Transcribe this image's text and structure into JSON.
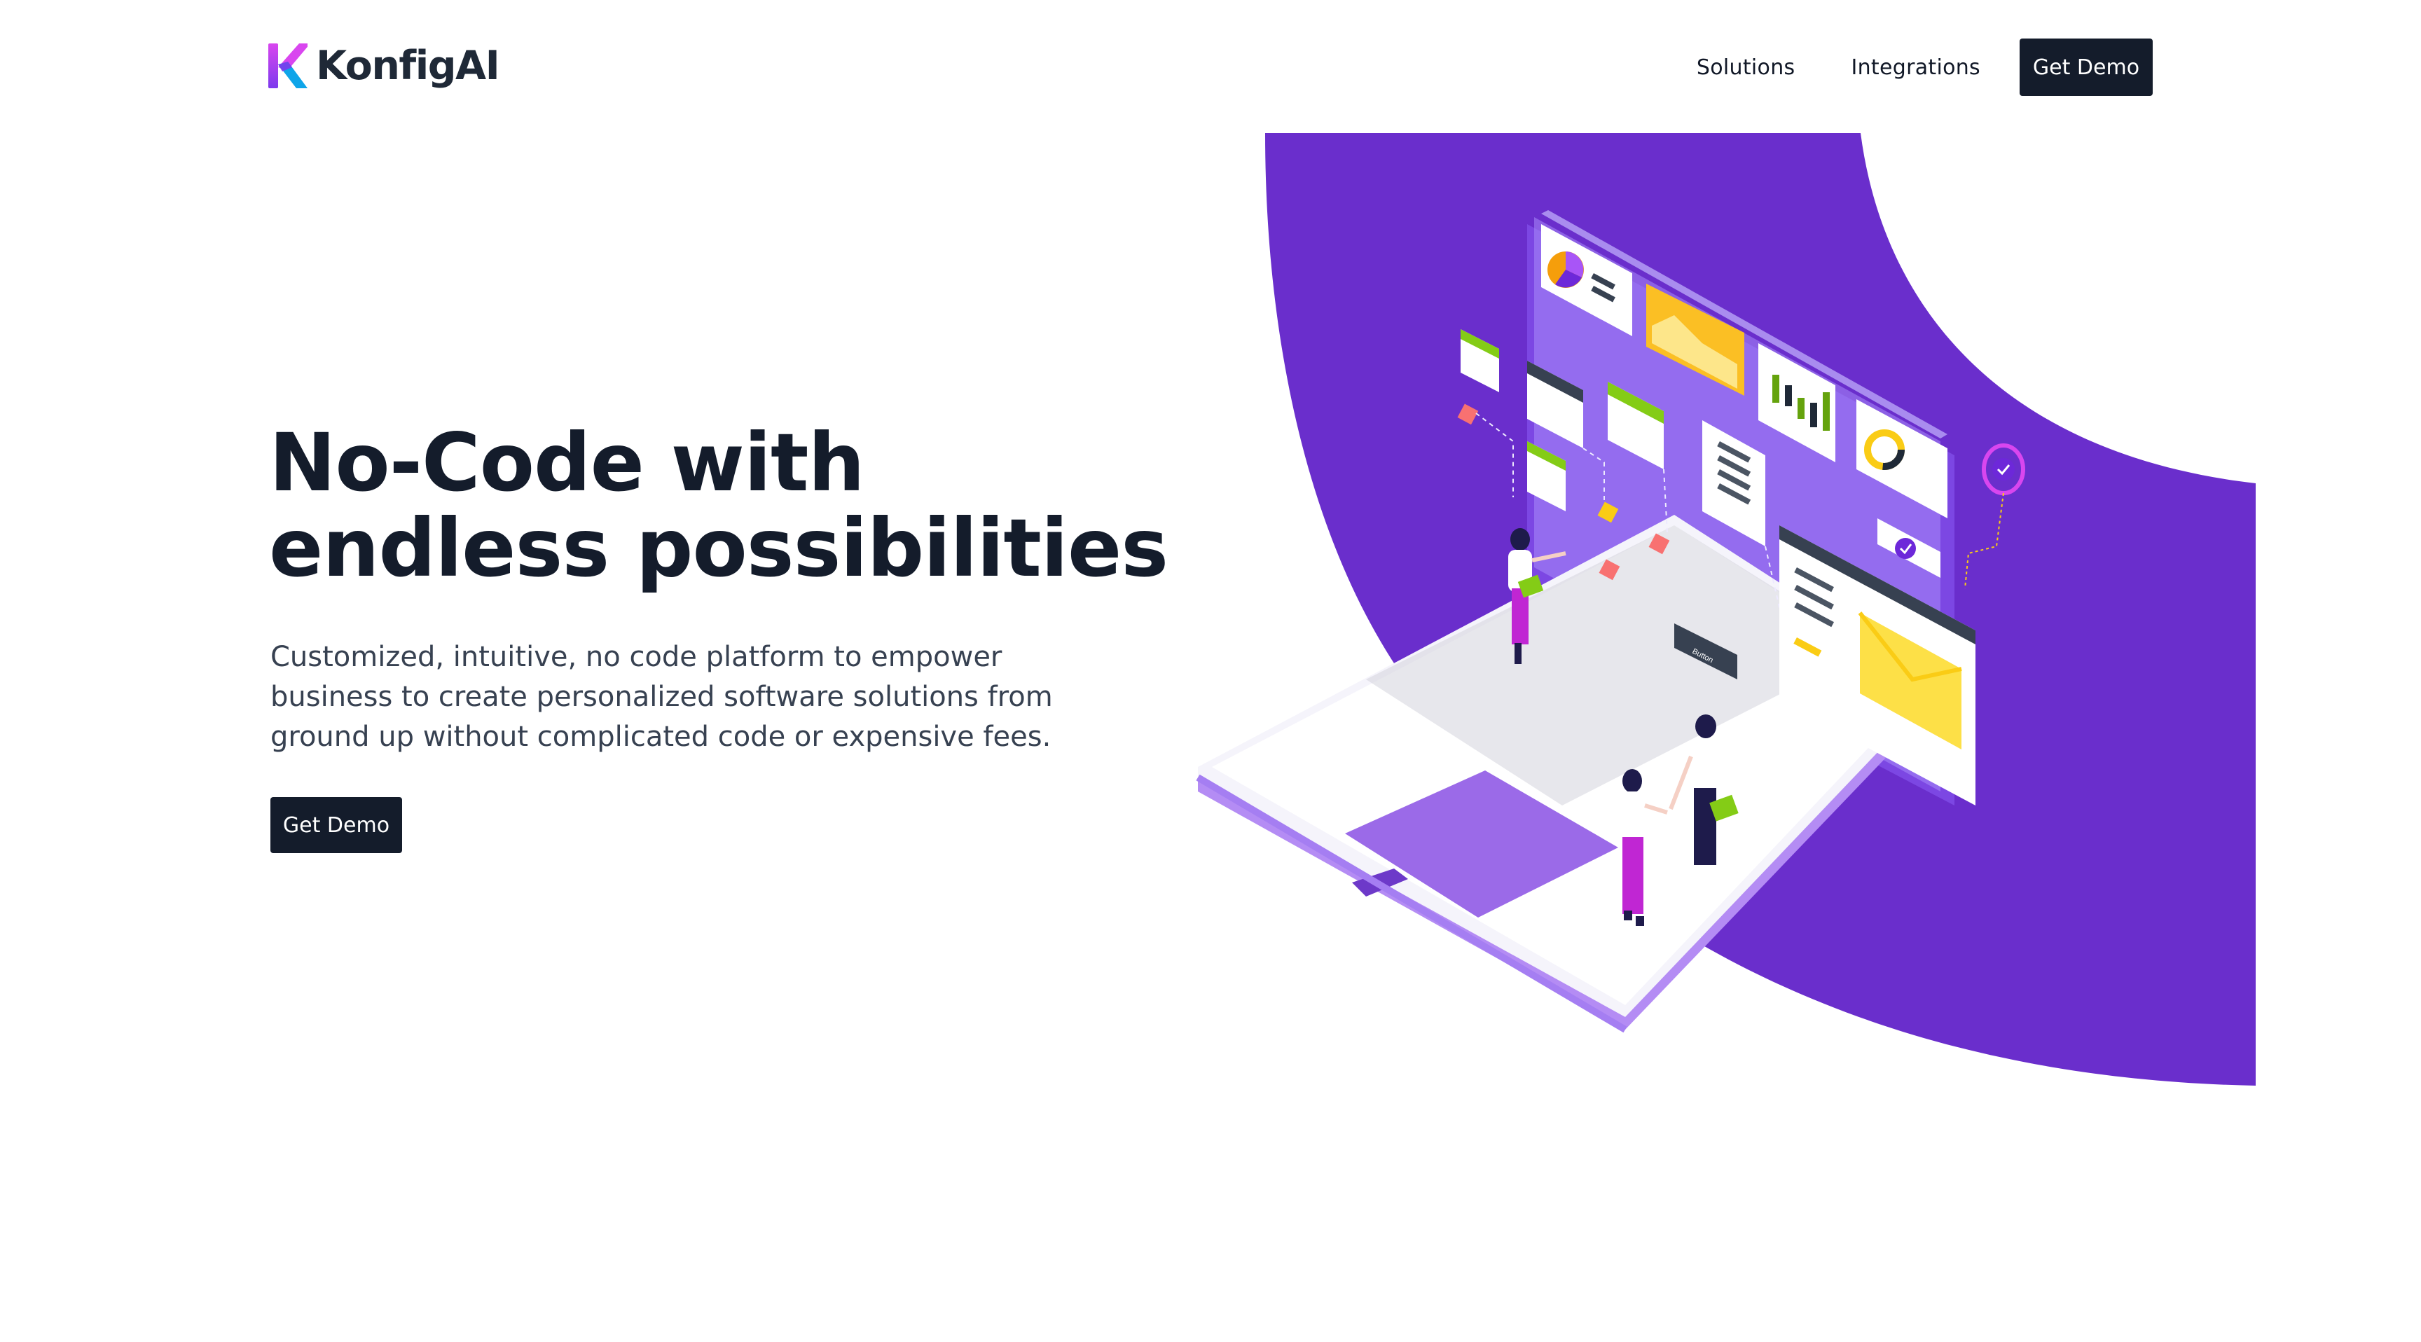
{
  "brand": {
    "name": "KonfigAI",
    "colors": {
      "pink": "#d946ef",
      "purple": "#7c3aed",
      "blue": "#0ea5e9"
    }
  },
  "nav": {
    "links": [
      "Solutions",
      "Integrations"
    ],
    "cta": "Get Demo"
  },
  "hero": {
    "title_lines": [
      "No-Code with",
      "endless possibilities"
    ],
    "description": "Customized, intuitive, no code platform to empower business to create personalized software solutions from ground up without complicated code or expensive fees.",
    "cta": "Get Demo"
  },
  "illustration": {
    "button_label": "Button",
    "icons": [
      "laptop-illustration",
      "chart-cards",
      "people-figures",
      "check-badge-icon"
    ]
  },
  "colors": {
    "primary_dark": "#141c2b",
    "accent_purple": "#6a2ecc",
    "light_purple": "#9b6ae8"
  }
}
